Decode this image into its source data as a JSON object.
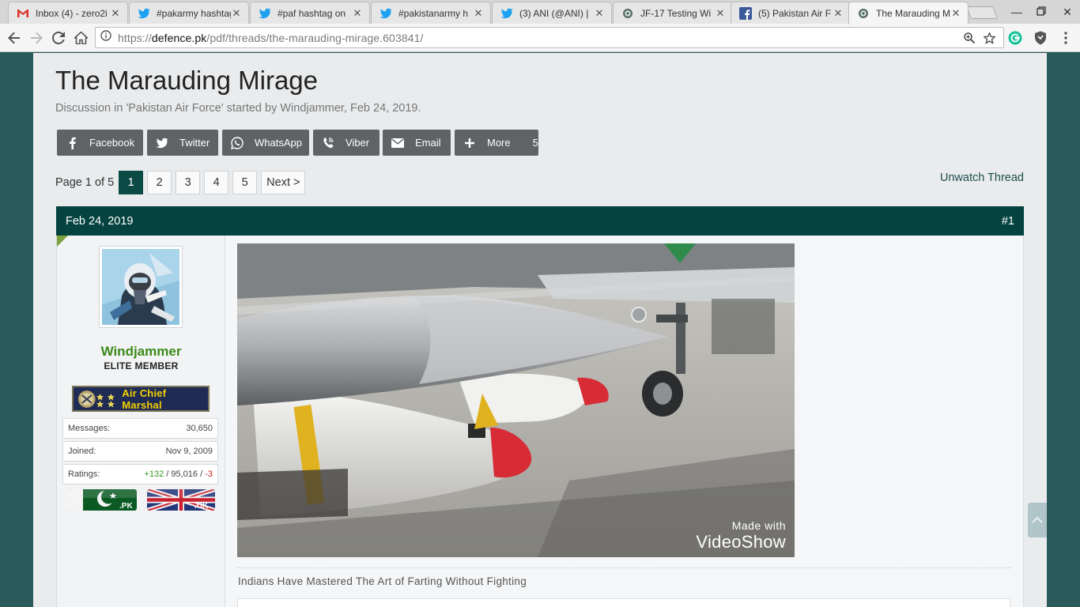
{
  "browser": {
    "tabs": [
      {
        "title": "Inbox (4) - zero2i",
        "icon": "gmail-icon"
      },
      {
        "title": "#pakarmy hashtag",
        "icon": "twitter-icon"
      },
      {
        "title": "#paf hashtag on",
        "icon": "twitter-icon"
      },
      {
        "title": "#pakistanarmy h",
        "icon": "twitter-icon"
      },
      {
        "title": "(3) ANI (@ANI) |",
        "icon": "twitter-icon"
      },
      {
        "title": "JF-17 Testing Wi",
        "icon": "defencepk-icon"
      },
      {
        "title": "(5) Pakistan Air F",
        "icon": "facebook-icon"
      },
      {
        "title": "The Marauding M",
        "icon": "defencepk-icon"
      }
    ],
    "url": {
      "scheme": "https://",
      "host": "defence.pk",
      "path": "/pdf/threads/the-marauding-mirage.603841/"
    }
  },
  "thread": {
    "title": "The Marauding Mirage",
    "description": "Discussion in 'Pakistan Air Force' started by Windjammer, Feb 24, 2019."
  },
  "share": {
    "facebook": "Facebook",
    "twitter": "Twitter",
    "whatsapp": "WhatsApp",
    "viber": "Viber",
    "email": "Email",
    "more": "More",
    "more_count": "5"
  },
  "pagination": {
    "label": "Page 1 of 5",
    "pages": [
      "1",
      "2",
      "3",
      "4",
      "5"
    ],
    "next": "Next >",
    "unwatch": "Unwatch Thread"
  },
  "post": {
    "date": "Feb 24, 2019",
    "number": "#1",
    "user": {
      "name": "Windjammer",
      "title": "ELITE MEMBER",
      "rank": "Air Chief Marshal",
      "messages_label": "Messages:",
      "messages": "30,650",
      "joined_label": "Joined:",
      "joined": "Nov 9, 2009",
      "ratings_label": "Ratings:",
      "ratings_pos": "+132",
      "ratings_sep1": " / ",
      "ratings_neutral": "95,016",
      "ratings_sep2": " / ",
      "ratings_neg": "-3",
      "flag_left": ".PK",
      "flag_right": ".UK"
    },
    "video_watermark": {
      "line1": "Made with",
      "line2": "VideoShow"
    },
    "text": "Indians Have Mastered The Art of Farting Without Fighting"
  },
  "colors": {
    "header": "#04433f",
    "share_button": "#5f6366",
    "username": "#3a8a19",
    "page_bg": "#e9ebed"
  }
}
